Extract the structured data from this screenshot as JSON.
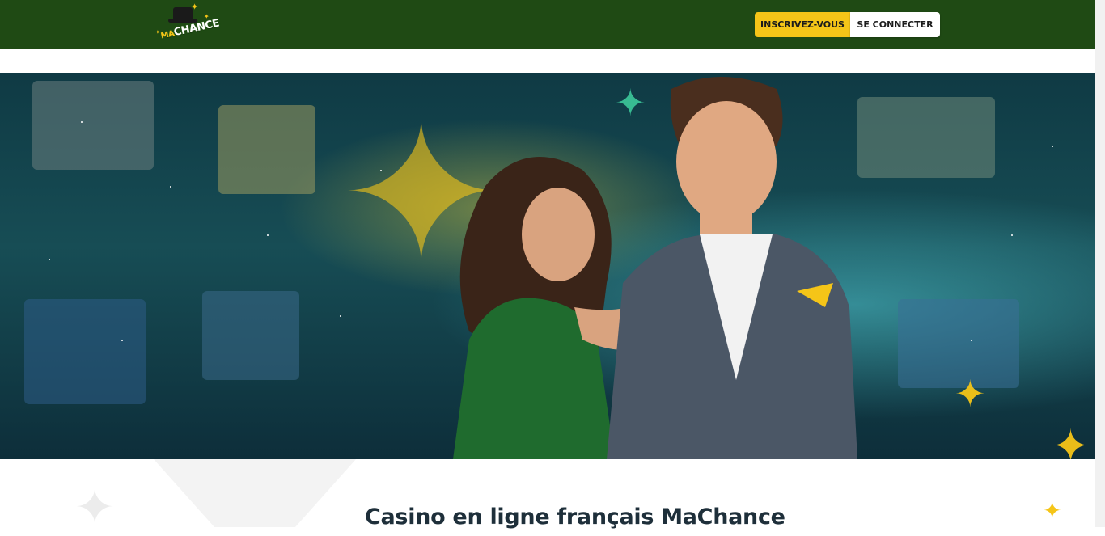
{
  "header": {
    "logo": {
      "brand_small": "MA",
      "brand_main": "CHANCE"
    },
    "register_label": "INSCRIVEZ-VOUS",
    "login_label": "SE CONNECTER"
  },
  "hero": {
    "image_icon": "hero-banner-image"
  },
  "main": {
    "title": "Casino en ligne français MaChance"
  },
  "colors": {
    "header_bg": "#1f4a14",
    "accent_yellow": "#f5c518",
    "title_text": "#1e2f3a"
  }
}
